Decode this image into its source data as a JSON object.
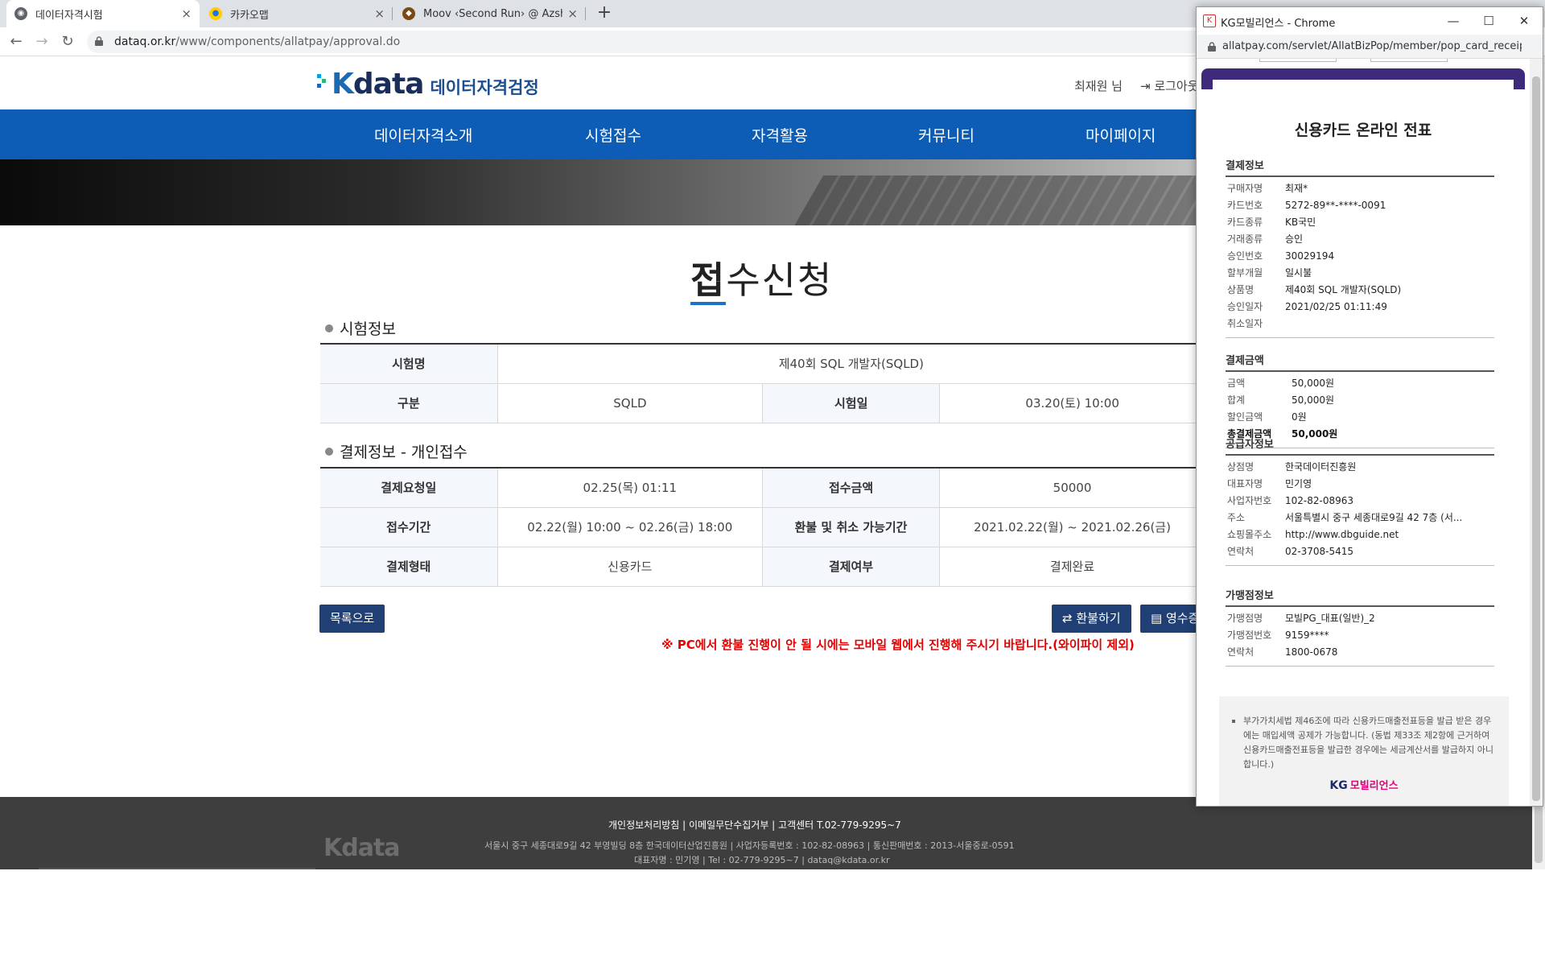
{
  "browser": {
    "tabs": [
      {
        "title": "데이터자격시험",
        "favicon": "globe-icon"
      },
      {
        "title": "카카오맵",
        "favicon": "kakaomap-icon"
      },
      {
        "title": "Moov ‹Second Run› @ Azshara",
        "favicon": "game-icon"
      }
    ],
    "close_glyph": "×",
    "newtab_glyph": "+",
    "url_host": "dataq.or.kr",
    "url_path": "/www/components/allatpay/approval.do"
  },
  "site": {
    "logo_k": "K",
    "logo_data": "data",
    "logo_kr": "데이터자격검정",
    "user_name": "최재원 님",
    "login_label": "로그아웃",
    "nav": [
      "데이터자격소개",
      "시험접수",
      "자격활용",
      "커뮤니티",
      "마이페이지"
    ]
  },
  "main": {
    "title_first": "접",
    "title_rest": "수신청",
    "exam_section": "시험정보",
    "exam": {
      "name_label": "시험명",
      "name_value": "제40회 SQL 개발자(SQLD)",
      "type_label": "구분",
      "type_value": "SQLD",
      "date_label": "시험일",
      "date_value": "03.20(토) 10:00"
    },
    "pay_section": "결제정보 - 개인접수",
    "pay": {
      "req_date_label": "결제요청일",
      "req_date_value": "02.25(목) 01:11",
      "amount_label": "접수금액",
      "amount_value": "50000",
      "period_label": "접수기간",
      "period_value": "02.22(월) 10:00 ~ 02.26(금) 18:00",
      "refund_label": "환불 및 취소 가능기간",
      "refund_value": "2021.02.22(월) ~ 2021.02.26(금)",
      "method_label": "결제형태",
      "method_value": "신용카드",
      "status_label": "결제여부",
      "status_value": "결제완료"
    },
    "list_button": "목록으로",
    "refund_button": "환불하기",
    "receipt_button": "영수증",
    "notice": "※ PC에서 환불 진행이 안 될 시에는 모바일 웹에서 진행해 주시기 바랍니다.(와이파이 제외)"
  },
  "footer": {
    "logo": "Kdata",
    "links": "개인정보처리방침  |  이메일무단수집거부  |  고객센터 T.02-779-9295~7",
    "address": "서울시 중구 세종대로9길 42 부영빌딩 8층 한국데이터산업진흥원  |  사업자등록번호 : 102-82-08963  |  통신판매번호 : 2013-서울중로-0591",
    "contact": "대표자명 : 민기영  |  Tel : 02-779-9295~7  |  dataq@kdata.or.kr"
  },
  "popup": {
    "window_title": "KG모빌리언스 - Chrome",
    "favicon": "kg-icon",
    "controls": {
      "minimize": "—",
      "maximize": "☐",
      "close": "✕"
    },
    "url": "allatpay.com/servlet/AllatBizPop/member/pop_card_receipt",
    "title": "신용카드 온라인 전표",
    "payment": {
      "heading": "결제정보",
      "rows": [
        {
          "k": "구매자명",
          "v": "최재*"
        },
        {
          "k": "카드번호",
          "v": "5272-89**-****-0091"
        },
        {
          "k": "카드종류",
          "v": "KB국민"
        },
        {
          "k": "거래종류",
          "v": "승인"
        },
        {
          "k": "승인번호",
          "v": "30029194"
        },
        {
          "k": "할부개월",
          "v": "일시불"
        },
        {
          "k": "상품명",
          "v": "제40회 SQL 개발자(SQLD)"
        },
        {
          "k": "승인일자",
          "v": "2021/02/25 01:11:49"
        },
        {
          "k": "취소일자",
          "v": ""
        }
      ]
    },
    "amount": {
      "heading": "결제금액",
      "rows": [
        {
          "k": "금액",
          "v": "50,000원"
        },
        {
          "k": "합계",
          "v": "50,000원"
        },
        {
          "k": "할인금액",
          "v": "0원"
        },
        {
          "k": "총결제금액",
          "v": "50,000원"
        }
      ]
    },
    "supplier": {
      "heading": "공급자정보",
      "rows": [
        {
          "k": "상점명",
          "v": "한국데이터진흥원"
        },
        {
          "k": "대표자명",
          "v": "민기영"
        },
        {
          "k": "사업자번호",
          "v": "102-82-08963"
        },
        {
          "k": "주소",
          "v": "서울특별시 중구 세종대로9길 42 7층 (서..."
        },
        {
          "k": "쇼핑몰주소",
          "v": "http://www.dbguide.net"
        },
        {
          "k": "연락처",
          "v": "02-3708-5415"
        }
      ]
    },
    "merchant": {
      "heading": "가맹점정보",
      "rows": [
        {
          "k": "가맹점명",
          "v": "모빌PG_대표(일반)_2"
        },
        {
          "k": "가맹점번호",
          "v": "9159****"
        },
        {
          "k": "연락처",
          "v": "1800-0678"
        }
      ]
    },
    "note": "부가가치세법 제46조에 따라 신용카드매출전표등을 발급 받은 경우에는 매입세액 공제가 가능합니다. (동법 제33조 제2항에 근거하여 신용카드매출전표등을 발급한 경우에는 세금계산서를 발급하지 아니합니다.)",
    "kg_logo_kg": "KG",
    "kg_logo_text": "모빌리언스"
  }
}
